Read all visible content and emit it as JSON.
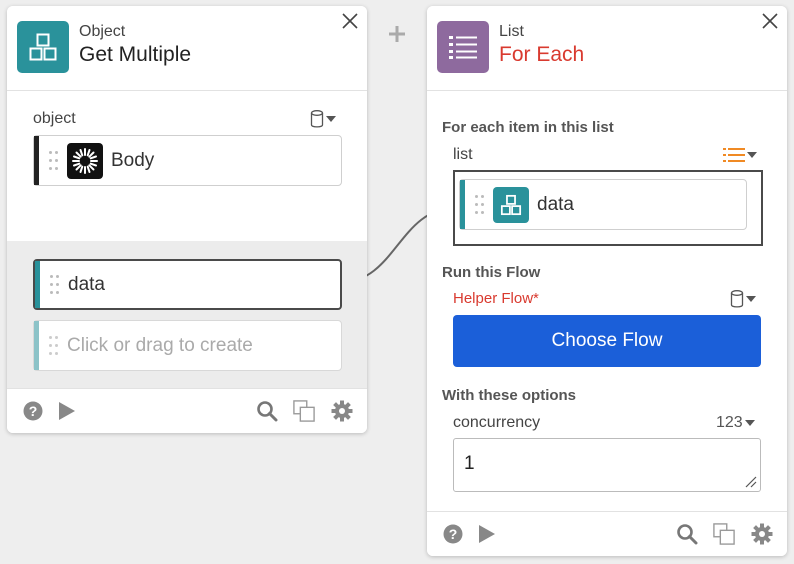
{
  "left_card": {
    "header": {
      "subtitle": "Object",
      "title": "Get Multiple"
    },
    "object_field": {
      "label": "object",
      "value": "Body"
    },
    "outputs": [
      {
        "label": "data"
      },
      {
        "label": "Click or drag to create"
      }
    ]
  },
  "right_card": {
    "header": {
      "subtitle": "List",
      "title": "For Each"
    },
    "for_each_heading": "For each item in this list",
    "list_field": {
      "label": "list",
      "value": "data"
    },
    "run_heading": "Run this Flow",
    "helper_flow": {
      "label": "Helper Flow",
      "required_mark": "*"
    },
    "choose_flow_button": "Choose Flow",
    "options_heading": "With these options",
    "concurrency": {
      "label": "concurrency",
      "type_label": "123",
      "value": "1"
    }
  },
  "colors": {
    "teal": "#2a929b",
    "purple": "#8e6a9e",
    "accent_blue": "#1b5fd9",
    "required_red": "#d93a2f",
    "list_orange": "#f08a24"
  }
}
